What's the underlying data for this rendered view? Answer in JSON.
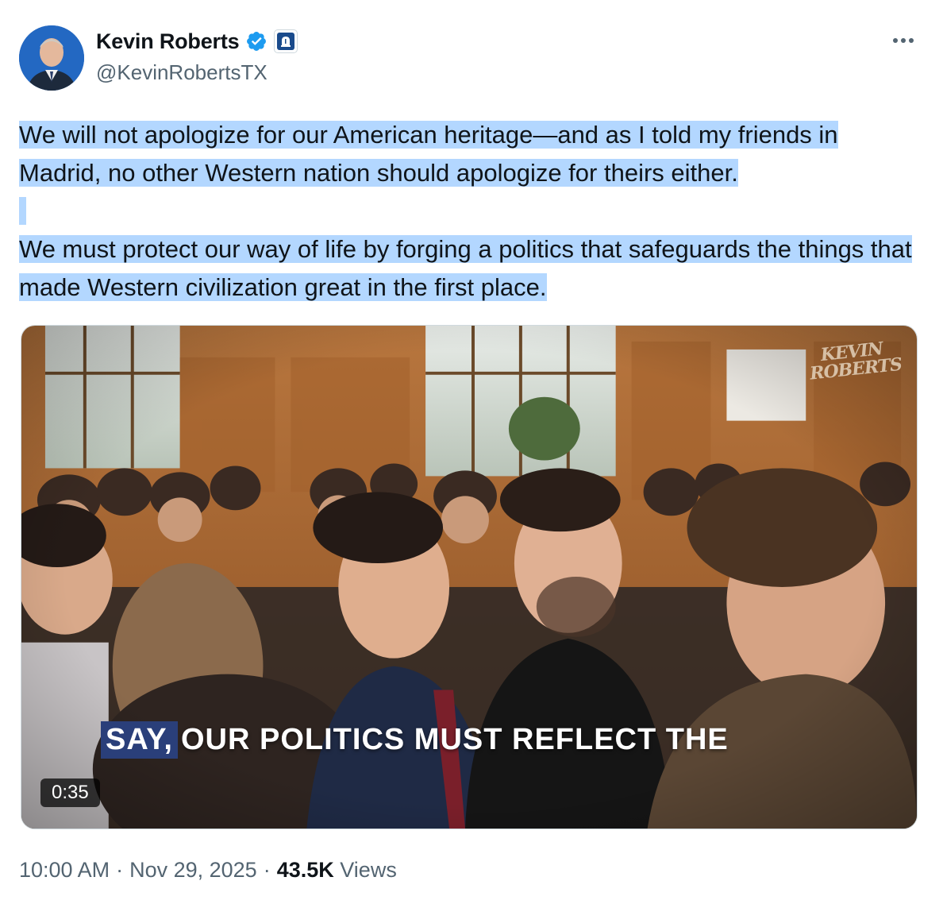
{
  "author": {
    "name": "Kevin Roberts",
    "handle": "@KevinRobertsTX",
    "verified_icon": "verified-badge-icon",
    "affiliate_icon": "liberty-bell-icon",
    "accent_color": "#1d9bf0"
  },
  "menu": {
    "icon": "more-options-icon"
  },
  "post": {
    "paragraphs": [
      "We will not apologize for our American heritage—and as I told my friends in Madrid, no other Western nation should apologize for theirs either.",
      "We must protect our way of life by forging a politics that safeguards the things that made Western civilization great in the first place."
    ],
    "selection_color": "#b3d7ff"
  },
  "video": {
    "watermark_line1": "KEVIN",
    "watermark_line2": "ROBERTS",
    "caption_highlight": "SAY,",
    "caption_rest": "OUR POLITICS MUST REFLECT THE",
    "duration": "0:35"
  },
  "meta": {
    "time": "10:00 AM",
    "separator": "·",
    "date": "Nov 29, 2025",
    "views_count": "43.5K",
    "views_label": "Views"
  }
}
